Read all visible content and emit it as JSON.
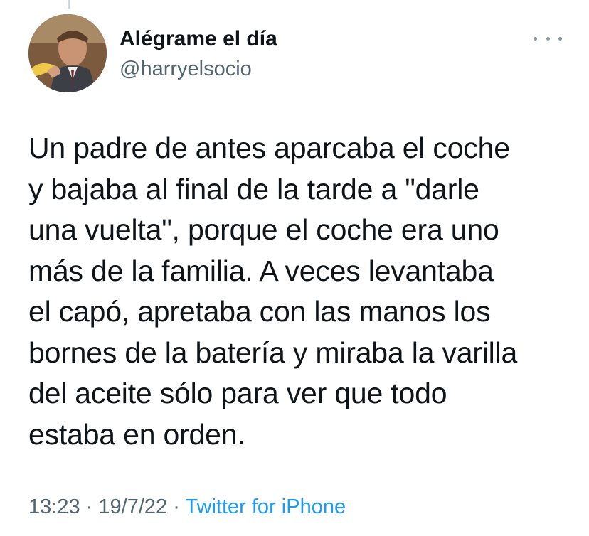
{
  "tweet": {
    "author": {
      "display_name": "Alégrame el día",
      "handle": "@harryelsocio"
    },
    "text_lines": [
      "Un padre de antes aparcaba el coche",
      "y bajaba al final de la tarde a \"darle",
      "una vuelta\", porque el coche era uno",
      "más de la familia. A veces levantaba",
      "el capó, apretaba con las manos los",
      "bornes de la batería y miraba la varilla",
      "del aceite sólo para ver que todo",
      "estaba en orden."
    ],
    "time": "13:23",
    "separator": "·",
    "date": "19/7/22",
    "source": "Twitter for iPhone"
  },
  "icons": {
    "more": "more-options-icon"
  },
  "colors": {
    "text": "#0f1419",
    "secondary": "#536471",
    "link": "#1d9bf0",
    "thread_line": "#cfd9de"
  }
}
